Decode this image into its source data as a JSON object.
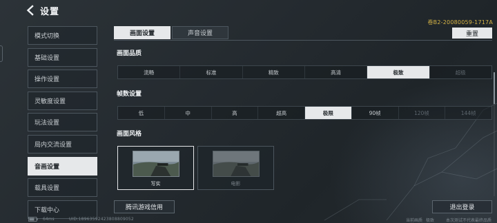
{
  "header": {
    "title": "设置",
    "back_icon": "chevron-left-icon"
  },
  "license": "卷B2-20080059-1717A",
  "sidebar": {
    "items": [
      {
        "label": "模式切换",
        "active": false
      },
      {
        "label": "基础设置",
        "active": false
      },
      {
        "label": "操作设置",
        "active": false
      },
      {
        "label": "灵敏度设置",
        "active": false
      },
      {
        "label": "玩法设置",
        "active": false
      },
      {
        "label": "局内交流设置",
        "active": false
      },
      {
        "label": "音画设置",
        "active": true
      },
      {
        "label": "载具设置",
        "active": false
      },
      {
        "label": "下载中心",
        "active": false
      }
    ]
  },
  "tabs": [
    {
      "label": "画面设置",
      "active": true
    },
    {
      "label": "声音设置",
      "active": false
    }
  ],
  "reset_label": "重置",
  "graphics_quality": {
    "title": "画面品质",
    "options": [
      {
        "label": "流畅",
        "state": "normal"
      },
      {
        "label": "标准",
        "state": "normal"
      },
      {
        "label": "精致",
        "state": "normal"
      },
      {
        "label": "高清",
        "state": "normal"
      },
      {
        "label": "极致",
        "state": "selected"
      },
      {
        "label": "超极",
        "state": "disabled"
      }
    ]
  },
  "frame_rate": {
    "title": "帧数设置",
    "options": [
      {
        "label": "低",
        "state": "normal"
      },
      {
        "label": "中",
        "state": "normal"
      },
      {
        "label": "高",
        "state": "normal"
      },
      {
        "label": "超高",
        "state": "normal"
      },
      {
        "label": "极限",
        "state": "selected"
      },
      {
        "label": "90帧",
        "state": "normal"
      },
      {
        "label": "120帧",
        "state": "disabled"
      },
      {
        "label": "144帧",
        "state": "disabled"
      }
    ]
  },
  "picture_style": {
    "title": "画面风格",
    "cards": [
      {
        "label": "写实",
        "selected": true
      },
      {
        "label": "电影",
        "selected": false
      }
    ]
  },
  "buttons": {
    "tencent_credit": "腾讯游戏信用",
    "logout": "退出登录"
  },
  "statusbar": {
    "ping": "64ms",
    "uid": "UID:18963592423808809052",
    "quality_note": "当前画质",
    "quality_value": "极致",
    "test_note": "本次测试不代表最终品质"
  },
  "colors": {
    "accent_yellow": "#d6b446",
    "selected_bg": "#e6e8ea",
    "panel_bg": "#242a2f"
  }
}
